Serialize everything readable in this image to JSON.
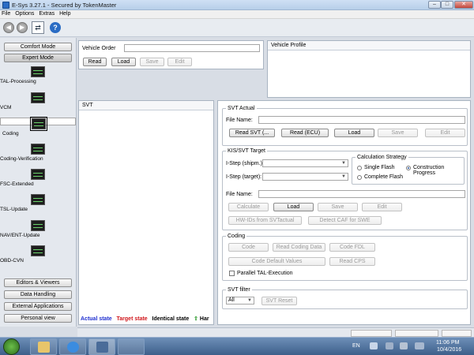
{
  "window": {
    "title": "E-Sys 3.27.1 - Secured by TokenMaster",
    "minimize": "–",
    "maximize": "□",
    "close": "✕"
  },
  "menu": [
    "File",
    "Options",
    "Extras",
    "Help"
  ],
  "toolbar": {
    "back_icon": "back-arrow-icon",
    "forward_icon": "forward-arrow-icon",
    "connect_icon": "connect-icon",
    "help_icon": "help-icon",
    "help_glyph": "?"
  },
  "sidebar": {
    "modes": [
      "Comfort Mode",
      "Expert Mode"
    ],
    "items": [
      "TAL-Processing",
      "VCM",
      "Coding",
      "Coding-Verification",
      "FSC-Extended",
      "TSL-Update",
      "NAV/ENT-Update",
      "OBD-CVN"
    ],
    "bottom": [
      "Editors & Viewers",
      "Data Handling",
      "External Applications",
      "Personal view"
    ]
  },
  "vehicle_order": {
    "label": "Vehicle Order",
    "value": "",
    "read": "Read",
    "load": "Load",
    "save": "Save",
    "edit": "Edit"
  },
  "vehicle_profile": {
    "title": "Vehicle Profile"
  },
  "svt": {
    "title": "SVT",
    "legend": {
      "actual": "Actual state",
      "target": "Target state",
      "identical": "Identical state",
      "arrow": "⇧",
      "har": "Har"
    },
    "colors": {
      "actual": "#1f2fd0",
      "target": "#d0161b",
      "identical": "#000000",
      "arrow": "#2e9b2e"
    }
  },
  "svt_actual": {
    "title": "SVT Actual",
    "file_label": "File Name:",
    "file_value": "",
    "read_svt": "Read SVT (...",
    "read_ecu": "Read (ECU)",
    "load": "Load",
    "save": "Save",
    "edit": "Edit"
  },
  "kis": {
    "title": "KIS/SVT Target",
    "istep_shipm": "I-Step (shipm.):",
    "istep_target": "I-Step (target):",
    "strategy_title": "Calculation Strategy",
    "single_flash": "Single Flash",
    "construction_progress": "Construction Progress",
    "complete_flash": "Complete Flash",
    "selected_strategy": "Construction Progress",
    "file_label": "File Name:",
    "file_value": "",
    "calculate": "Calculate",
    "load": "Load",
    "save": "Save",
    "edit": "Edit",
    "hw_ids": "HW-IDs from SVTactual",
    "detect_caf": "Detect CAF for SWE"
  },
  "coding": {
    "title": "Coding",
    "code": "Code",
    "read_coding_data": "Read Coding Data",
    "code_fdl": "Code FDL",
    "code_default": "Code Default Values",
    "read_cps": "Read CPS",
    "parallel": "Parallel TAL-Execution",
    "parallel_checked": false
  },
  "svt_filter": {
    "title": "SVT filter",
    "value": "All",
    "reset": "SVT Reset"
  },
  "taskbar": {
    "lang": "EN",
    "time": "11:06 PM",
    "date": "10/4/2016"
  }
}
